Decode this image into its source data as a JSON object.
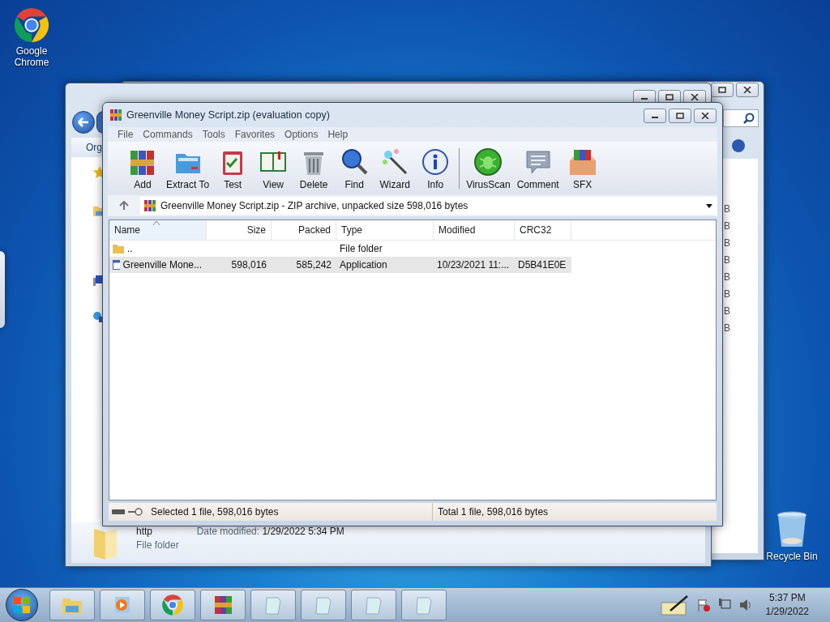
{
  "desktop_icons": [
    {
      "label": "Google Chrome",
      "kind": "chrome"
    },
    {
      "label": "Recycle Bin",
      "kind": "recycle"
    }
  ],
  "back_window": {
    "column_fragments": [
      "B",
      "B",
      "B",
      "B",
      "B",
      "B",
      "B",
      "B"
    ]
  },
  "explorer": {
    "toolbar_text": "Org",
    "details": {
      "name": "http",
      "modified_label": "Date modified:",
      "modified": "1/29/2022 5:34 PM",
      "type": "File folder"
    }
  },
  "winrar": {
    "title": "Greenville Money Script.zip (evaluation copy)",
    "menu": [
      "File",
      "Commands",
      "Tools",
      "Favorites",
      "Options",
      "Help"
    ],
    "toolbar": [
      {
        "label": "Add",
        "kind": "add"
      },
      {
        "label": "Extract To",
        "kind": "extract"
      },
      {
        "label": "Test",
        "kind": "test"
      },
      {
        "label": "View",
        "kind": "view"
      },
      {
        "label": "Delete",
        "kind": "delete"
      },
      {
        "label": "Find",
        "kind": "find"
      },
      {
        "label": "Wizard",
        "kind": "wizard"
      },
      {
        "label": "Info",
        "kind": "info"
      },
      {
        "label": "VirusScan",
        "kind": "virus"
      },
      {
        "label": "Comment",
        "kind": "comment"
      },
      {
        "label": "SFX",
        "kind": "sfx"
      }
    ],
    "address": "Greenville Money Script.zip - ZIP archive, unpacked size 598,016 bytes",
    "columns": [
      "Name",
      "Size",
      "Packed",
      "Type",
      "Modified",
      "CRC32"
    ],
    "rows": [
      {
        "kind": "folder",
        "selected": false,
        "cells": [
          "..",
          "",
          "",
          "File folder",
          "",
          ""
        ]
      },
      {
        "kind": "app",
        "selected": true,
        "cells": [
          "Greenville Mone...",
          "598,016",
          "585,242",
          "Application",
          "10/23/2021 11:...",
          "D5B41E0E"
        ]
      }
    ],
    "status_left": "Selected 1 file, 598,016 bytes",
    "status_right": "Total 1 file, 598,016 bytes"
  },
  "taskbar": {
    "buttons": [
      {
        "kind": "explorer"
      },
      {
        "kind": "media"
      },
      {
        "kind": "chrome"
      },
      {
        "kind": "winrar"
      },
      {
        "kind": "note"
      },
      {
        "kind": "note"
      },
      {
        "kind": "note"
      },
      {
        "kind": "note"
      }
    ],
    "time": "5:37 PM",
    "date": "1/29/2022"
  }
}
